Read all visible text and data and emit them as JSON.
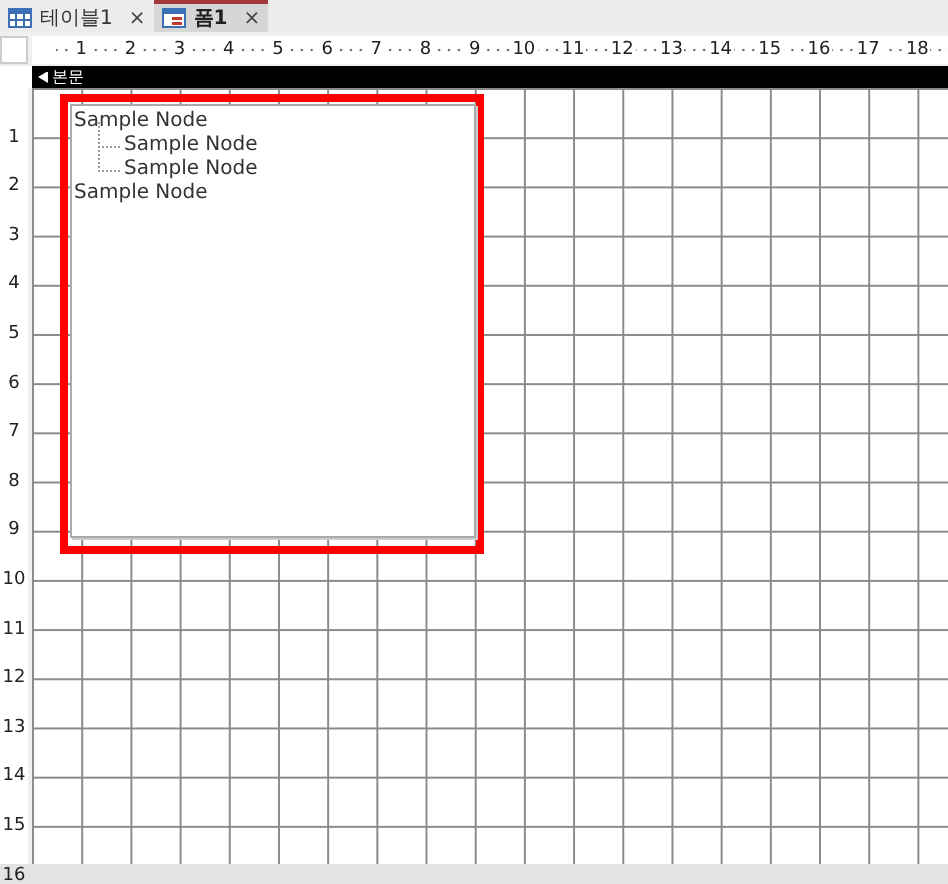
{
  "tabs": [
    {
      "kind": "table",
      "label": "테이블1",
      "close": "×",
      "selected": false
    },
    {
      "kind": "form",
      "label": "폼1",
      "close": "×",
      "selected": true
    }
  ],
  "ruler": {
    "horizontal": [
      "1",
      "2",
      "3",
      "4",
      "5",
      "6",
      "7",
      "8",
      "9",
      "10",
      "11",
      "12",
      "13",
      "14",
      "15",
      "16",
      "17",
      "18"
    ],
    "vertical": [
      "1",
      "2",
      "3",
      "4",
      "5",
      "6",
      "7",
      "8",
      "9",
      "10",
      "11",
      "12",
      "13",
      "14",
      "15",
      "16"
    ]
  },
  "section": {
    "title": "본문"
  },
  "tree": {
    "nodes": [
      {
        "label": "Sample Node",
        "children": [
          {
            "label": "Sample Node"
          },
          {
            "label": "Sample Node"
          }
        ]
      },
      {
        "label": "Sample Node"
      }
    ]
  }
}
